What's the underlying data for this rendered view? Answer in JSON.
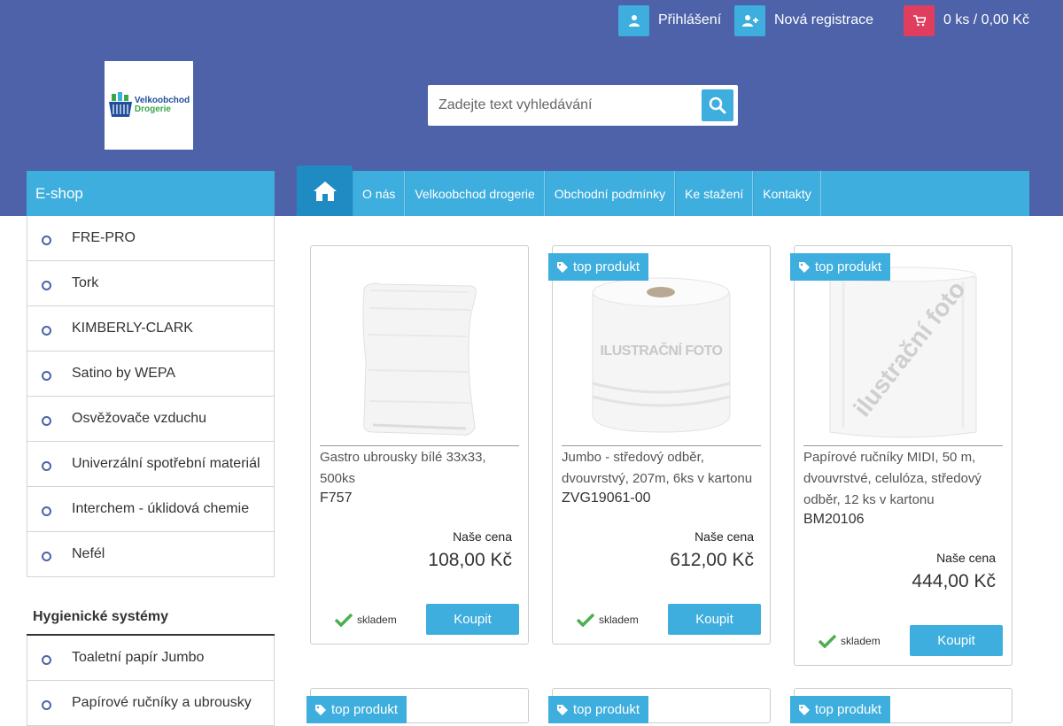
{
  "topbar": {
    "login_label": "Přihlášení",
    "register_label": "Nová registrace",
    "cart_label": "0 ks / 0,00 Kč"
  },
  "logo": {
    "line1": "Velkoobchod",
    "line2": "Drogerie"
  },
  "search": {
    "placeholder": "Zadejte text vyhledávání"
  },
  "sidebar": {
    "title": "E-shop",
    "categories": [
      "FRE-PRO",
      "Tork",
      "KIMBERLY-CLARK",
      "Satino by WEPA",
      "Osvěžovače vzduchu",
      "Univerzální spotřební materiál",
      "Interchem - úklidová chemie",
      "Nefél"
    ],
    "section_title": "Hygienické systémy",
    "section_items": [
      "Toaletní papír Jumbo",
      "Papírové ručníky a ubrousky"
    ]
  },
  "nav": {
    "items": [
      "O nás",
      "Velkoobchod drogerie",
      "Obchodní podmínky",
      "Ke stažení",
      "Kontakty"
    ]
  },
  "products": [
    {
      "badge": "",
      "name": "Gastro ubrousky bílé 33x33, 500ks",
      "code": "F757",
      "price_label": "Naše cena",
      "price": "108,00 Kč",
      "stock": "skladem",
      "buy": "Koupit"
    },
    {
      "badge": "top produkt",
      "watermark": "ILUSTRAČNÍ FOTO",
      "name": "Jumbo - středový odběr, dvouvrstvý, 207m, 6ks v kartonu",
      "code": "ZVG19061-00",
      "price_label": "Naše cena",
      "price": "612,00 Kč",
      "stock": "skladem",
      "buy": "Koupit"
    },
    {
      "badge": "top produkt",
      "watermark": "ilustrační foto",
      "name": "Papírové ručníky MIDI, 50 m, dvouvrstvé, celulóza, středový odběr, 12 ks v kartonu",
      "code": "BM20106",
      "price_label": "Naše cena",
      "price": "444,00 Kč",
      "stock": "skladem",
      "buy": "Koupit"
    }
  ],
  "bottom_badges": [
    "top produkt",
    "top produkt",
    "top produkt"
  ],
  "colors": {
    "header_bg": "#4d62a8",
    "accent": "#3eaede",
    "cart_red": "#e03e5e",
    "home_dark": "#1e8bc3",
    "stock_green": "#4caf50"
  }
}
